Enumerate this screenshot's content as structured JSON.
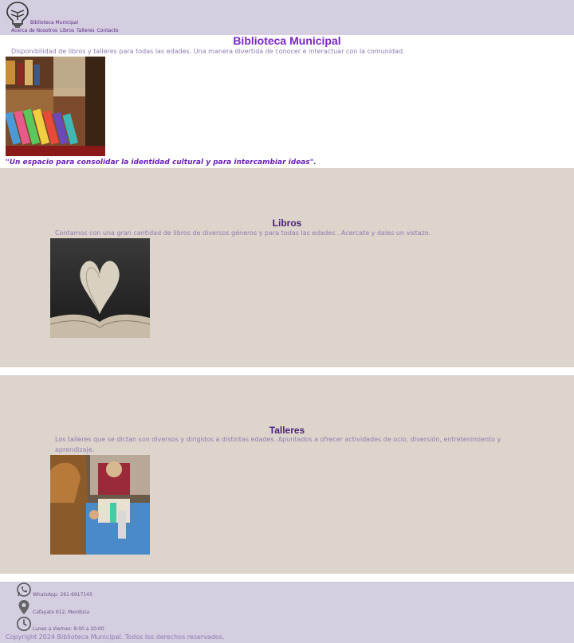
{
  "header": {
    "brand": "Biblioteca Municipal",
    "logo_icon": "lightbulb-book-icon",
    "nav": [
      "Acerca de Nosotros",
      "Libros",
      "Talleres",
      "Contacto"
    ]
  },
  "hero": {
    "title": "Biblioteca Municipal",
    "text": "Disponibilidad de libros y talleres para todas las edades. Una manera divertida de conocer e interactuar con la comunidad.",
    "quote": "\"Un espacio para consolidar la identidad cultural y para intercambiar ideas\"."
  },
  "libros": {
    "title": "Libros",
    "text": "Contamos con una gran cantidad de libros de diversos géneros y para todas las edades . Acercate y dales un vistazo."
  },
  "talleres": {
    "title": "Talleres",
    "text": "Los talleres que se dictan son diversos y dirigidos a distintas edades. Apuntados a ofrecer actividades de ocio, diversión, entretenimiento y aprendizaje."
  },
  "footer": {
    "whatsapp": "WhatsApp: 261-6917145",
    "address": "Cafayate 612, Mendoza",
    "hours": "Lunes a Viernes: 8:00 a 20:00",
    "copyright": "Copyright 2024 Biblioteca Municipal. Todos los derechos reservados."
  },
  "colors": {
    "header_bg": "#d5cde0",
    "section_bg": "#ddd4cc",
    "title_purple": "#7a25c4",
    "text_purple": "#8e7bb0"
  }
}
